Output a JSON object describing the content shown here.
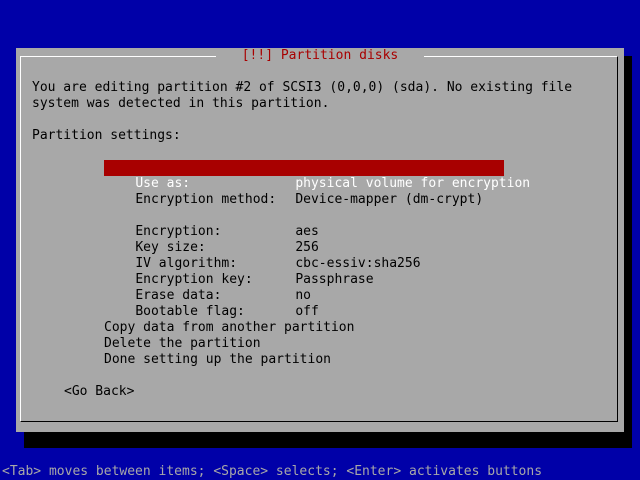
{
  "dialog": {
    "title": "[!!] Partition disks",
    "intro_line1": "You are editing partition #2 of SCSI3 (0,0,0) (sda). No existing file",
    "intro_line2": "system was detected in this partition.",
    "settings_heading": "Partition settings:"
  },
  "settings": [
    {
      "label": "Use as:",
      "value": "physical volume for encryption",
      "selected": true
    },
    {
      "label": "Encryption method:",
      "value": "Device-mapper (dm-crypt)"
    },
    {
      "label": "Encryption:",
      "value": "aes"
    },
    {
      "label": "Key size:",
      "value": "256"
    },
    {
      "label": "IV algorithm:",
      "value": "cbc-essiv:sha256"
    },
    {
      "label": "Encryption key:",
      "value": "Passphrase"
    },
    {
      "label": "Erase data:",
      "value": "no"
    },
    {
      "label": "Bootable flag:",
      "value": "off"
    }
  ],
  "actions": [
    "Copy data from another partition",
    "Delete the partition",
    "Done setting up the partition"
  ],
  "go_back_label": "<Go Back>",
  "help_text": "<Tab> moves between items; <Space> selects; <Enter> activates buttons",
  "colors": {
    "background": "#0000a8",
    "dialog": "#a8a8a8",
    "highlight": "#a80000",
    "title": "#a80000"
  }
}
